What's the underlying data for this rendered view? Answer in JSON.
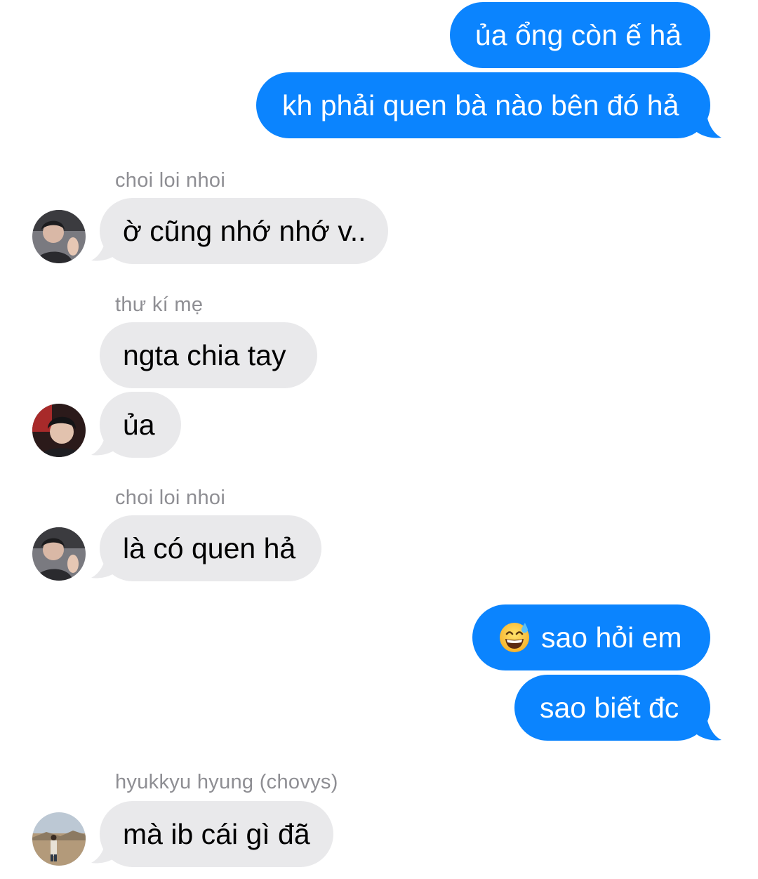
{
  "colors": {
    "outgoing_bubble": "#0b84fe",
    "incoming_bubble": "#e9e9eb",
    "sender_name": "#8e8e93"
  },
  "messages": [
    {
      "direction": "outgoing",
      "text": "ủa ổng còn ế hả"
    },
    {
      "direction": "outgoing",
      "text": "kh phải quen bà nào bên đó hả"
    },
    {
      "direction": "incoming",
      "sender": "choi loi nhoi",
      "text": "ờ cũng nhớ nhớ v.."
    },
    {
      "direction": "incoming",
      "sender": "thư kí mẹ",
      "text": "ngta chia tay"
    },
    {
      "direction": "incoming",
      "text": "ủa"
    },
    {
      "direction": "incoming",
      "sender": "choi loi nhoi",
      "text": "là có quen hả"
    },
    {
      "direction": "outgoing",
      "emoji": "grinning-face-with-sweat-icon",
      "text": "sao hỏi em"
    },
    {
      "direction": "outgoing",
      "text": "sao biết đc"
    },
    {
      "direction": "incoming",
      "sender": "hyukkyu hyung (chovys)",
      "text": "mà ib cái gì đã"
    }
  ]
}
